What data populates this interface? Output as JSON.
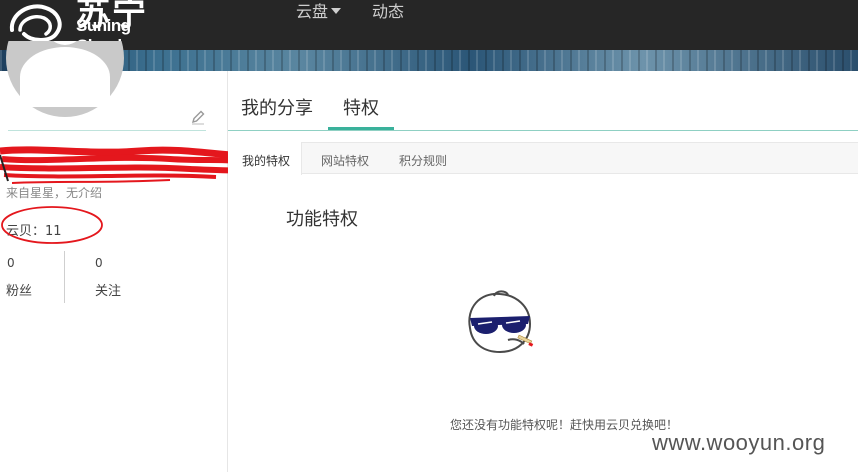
{
  "header": {
    "logo_cn": "苏宁云",
    "logo_en": "Suning Cloud",
    "nav": [
      {
        "label": "云盘",
        "has_dropdown": true
      },
      {
        "label": "动态"
      }
    ]
  },
  "profile": {
    "bio": "来自星星，无介绍",
    "cloud_shells": "云贝：11",
    "fans_count": "0",
    "fans_label": "粉丝",
    "following_count": "0",
    "following_label": "关注"
  },
  "main": {
    "tabs": [
      {
        "label": "我的分享"
      },
      {
        "label": "特权",
        "active": true
      }
    ],
    "sub_tabs": [
      {
        "label": "我的特权",
        "active": true
      },
      {
        "label": "网站特权"
      },
      {
        "label": "积分规则"
      }
    ],
    "section_title": "功能特权",
    "empty_message": "您还没有功能特权呢！赶快用云贝兑换吧！"
  },
  "watermark": "www.wooyun.org",
  "colors": {
    "topbar": "#262626",
    "accent": "#3ab19b",
    "annotation_red": "#e4171d"
  },
  "icons": [
    "cloud-logo-icon",
    "caret-down-icon",
    "avatar-placeholder-icon",
    "pencil-edit-icon",
    "sunglasses-mascot-icon"
  ]
}
